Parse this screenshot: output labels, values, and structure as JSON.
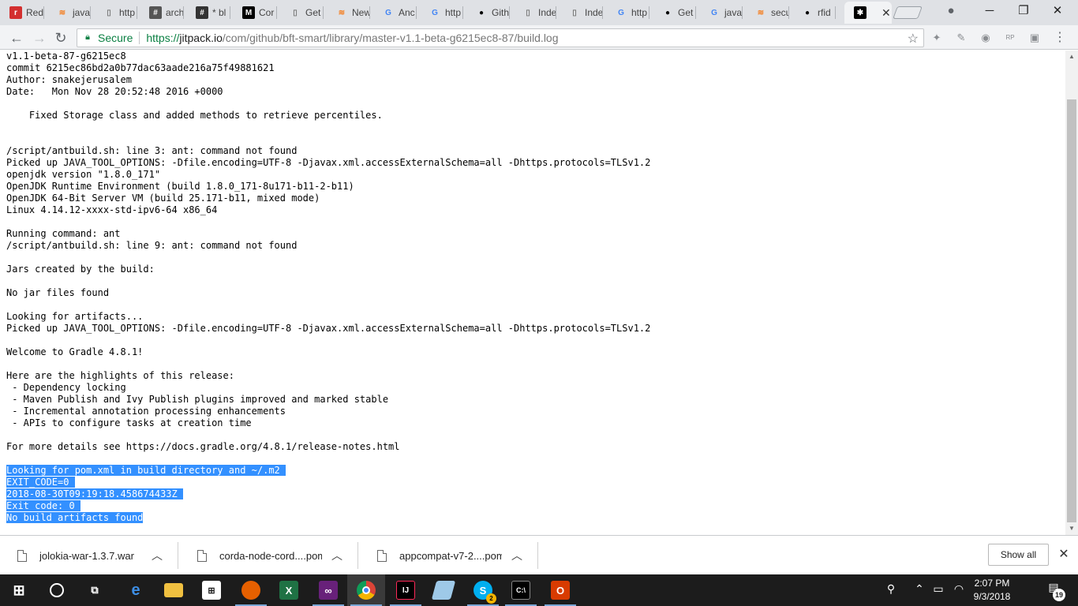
{
  "tabs": [
    {
      "label": "Red",
      "icon": "red-square-icon",
      "color": "#d32f2f"
    },
    {
      "label": "java",
      "icon": "stackoverflow-icon",
      "color": "#f48024"
    },
    {
      "label": "http",
      "icon": "page-icon",
      "color": "#777777"
    },
    {
      "label": "arch",
      "icon": "hash-icon",
      "color": "#555555"
    },
    {
      "label": "* bl",
      "icon": "hash-icon",
      "color": "#333333"
    },
    {
      "label": "Cor",
      "icon": "medium-icon",
      "color": "#000000"
    },
    {
      "label": "Get",
      "icon": "page-icon",
      "color": "#777777"
    },
    {
      "label": "New",
      "icon": "stackoverflow-icon",
      "color": "#f48024"
    },
    {
      "label": "Anc",
      "icon": "google-icon",
      "color": "#4285f4"
    },
    {
      "label": "http",
      "icon": "google-icon",
      "color": "#4285f4"
    },
    {
      "label": "Gith",
      "icon": "github-icon",
      "color": "#000000"
    },
    {
      "label": "Inde",
      "icon": "page-icon",
      "color": "#777777"
    },
    {
      "label": "Inde",
      "icon": "page-icon",
      "color": "#777777"
    },
    {
      "label": "http",
      "icon": "google-icon",
      "color": "#4285f4"
    },
    {
      "label": "Get",
      "icon": "github-icon",
      "color": "#000000"
    },
    {
      "label": "java",
      "icon": "google-icon",
      "color": "#4285f4"
    },
    {
      "label": "secu",
      "icon": "stackoverflow-icon",
      "color": "#f48024"
    },
    {
      "label": "rfid",
      "icon": "github-icon",
      "color": "#000000"
    }
  ],
  "active_tab": {
    "icon": "jitpack-icon",
    "close": "✕"
  },
  "address": {
    "secure_label": "Secure",
    "url_scheme": "https://",
    "url_host": "jitpack.io",
    "url_path": "/com/github/bft-smart/library/master-v1.1-beta-g6215ec8-87/build.log"
  },
  "log_lines": [
    "v1.1-beta-87-g6215ec8",
    "commit 6215ec86bd2a0b77dac63aade216a75f49881621",
    "Author: snakejerusalem",
    "Date:   Mon Nov 28 20:52:48 2016 +0000",
    "",
    "    Fixed Storage class and added methods to retrieve percentiles.",
    "",
    "",
    "/script/antbuild.sh: line 3: ant: command not found",
    "Picked up JAVA_TOOL_OPTIONS: -Dfile.encoding=UTF-8 -Djavax.xml.accessExternalSchema=all -Dhttps.protocols=TLSv1.2",
    "openjdk version \"1.8.0_171\"",
    "OpenJDK Runtime Environment (build 1.8.0_171-8u171-b11-2-b11)",
    "OpenJDK 64-Bit Server VM (build 25.171-b11, mixed mode)",
    "Linux 4.14.12-xxxx-std-ipv6-64 x86_64",
    "",
    "Running command: ant",
    "/script/antbuild.sh: line 9: ant: command not found",
    "",
    "Jars created by the build:",
    "",
    "No jar files found",
    "",
    "Looking for artifacts...",
    "Picked up JAVA_TOOL_OPTIONS: -Dfile.encoding=UTF-8 -Djavax.xml.accessExternalSchema=all -Dhttps.protocols=TLSv1.2",
    "",
    "Welcome to Gradle 4.8.1!",
    "",
    "Here are the highlights of this release:",
    " - Dependency locking",
    " - Maven Publish and Ivy Publish plugins improved and marked stable",
    " - Incremental annotation processing enhancements",
    " - APIs to configure tasks at creation time",
    "",
    "For more details see https://docs.gradle.org/4.8.1/release-notes.html",
    ""
  ],
  "selected_lines": [
    "Looking for pom.xml in build directory and ~/.m2 ",
    "EXIT_CODE=0 ",
    "2018-08-30T09:19:18.458674433Z ",
    "Exit code: 0 ",
    "No build artifacts found"
  ],
  "downloads": [
    {
      "name": "jolokia-war-1.3.7.war"
    },
    {
      "name": "corda-node-cord....pom"
    },
    {
      "name": "appcompat-v7-2....pom"
    }
  ],
  "shelf": {
    "show_all": "Show all"
  },
  "clock": {
    "time": "2:07 PM",
    "date": "9/3/2018"
  },
  "notifications": {
    "count": "19"
  },
  "skype_badge": "2",
  "colors": {
    "selection": "#3390ff",
    "secure": "#0b8043",
    "taskbar": "#1c1c1c"
  }
}
